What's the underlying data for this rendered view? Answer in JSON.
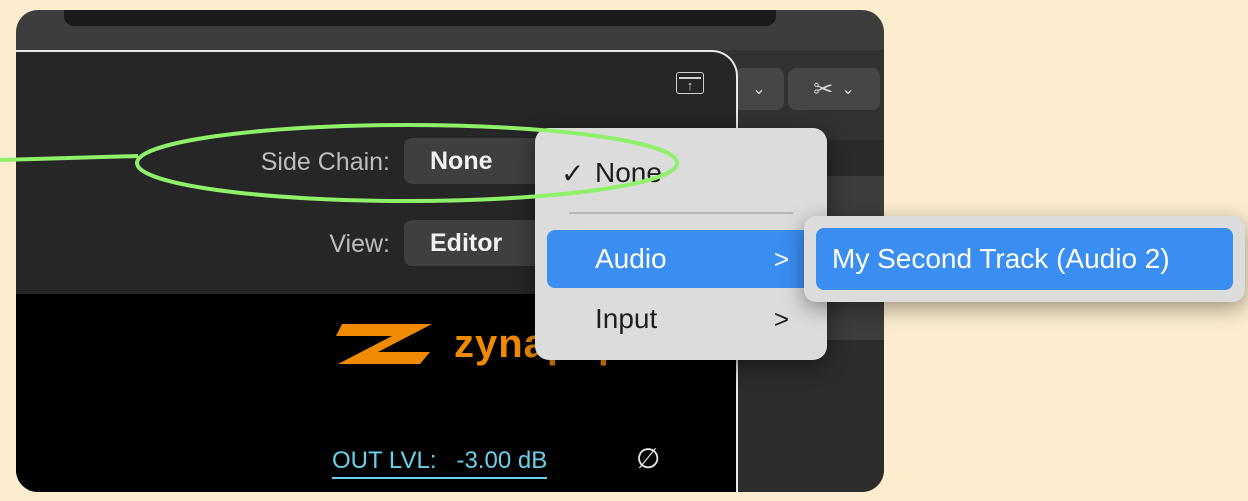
{
  "plugin": {
    "side_chain_label": "Side Chain:",
    "side_chain_value": "None",
    "view_label": "View:",
    "view_value": "Editor",
    "logo_text": "zynapiq",
    "out_level_label": "OUT LVL:",
    "out_level_value": "-3.00 dB",
    "phase_symbol": "∅"
  },
  "toolbar": {
    "float_icon": "float-window-icon",
    "scissors_icon": "✂",
    "chevron": "⌄"
  },
  "side_chain_menu": {
    "items": [
      {
        "label": "None",
        "checked": true,
        "check_glyph": "✓"
      },
      {
        "label": "Audio",
        "has_submenu": true,
        "selected": true,
        "arrow": ">"
      },
      {
        "label": "Input",
        "has_submenu": true,
        "arrow": ">"
      }
    ]
  },
  "audio_submenu": {
    "items": [
      {
        "label": "My Second Track (Audio 2)",
        "selected": true
      }
    ]
  },
  "colors": {
    "accent": "#3a8ef2",
    "annotation": "#8ff06a",
    "logo": "#f08a00",
    "out_level": "#6ad0ea",
    "background": "#fcedcf"
  }
}
